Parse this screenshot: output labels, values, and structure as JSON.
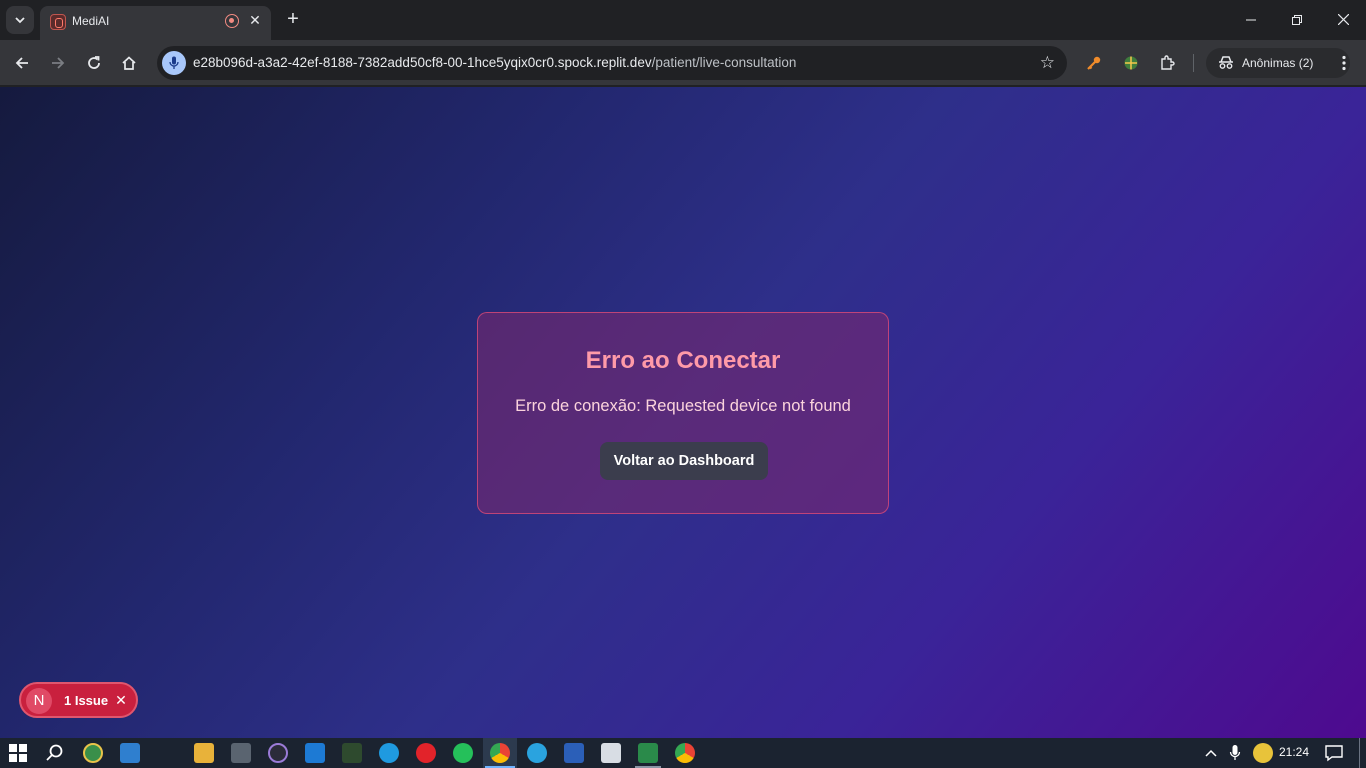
{
  "browser": {
    "tab_title": "MediAI",
    "url_host": "e28b096d-a3a2-42ef-8188-7382add50cf8-00-1hce5yqix0cr0.spock.replit.dev",
    "url_path": "/patient/live-consultation",
    "incognito_label": "Anônimas (2)"
  },
  "error_card": {
    "title": "Erro ao Conectar",
    "message": "Erro de conexão: Requested device not found",
    "button_label": "Voltar ao Dashboard"
  },
  "issue_badge": {
    "avatar_letter": "N",
    "label": "1 Issue"
  },
  "taskbar": {
    "time": "21:24"
  },
  "colors": {
    "card_title": "#ff9aa8",
    "issue_badge": "#c9203e",
    "page_gradient_start": "#151a3e",
    "page_gradient_end": "#4e0a8f"
  },
  "icons": [
    "tab-search-icon",
    "record-icon",
    "close-icon",
    "plus-icon",
    "minimize-icon",
    "restore-icon",
    "back-icon",
    "forward-icon",
    "reload-icon",
    "home-icon",
    "mic-icon",
    "star-icon",
    "extension-icon",
    "incognito-icon",
    "menu-icon",
    "windows-start-icon",
    "search-icon"
  ]
}
